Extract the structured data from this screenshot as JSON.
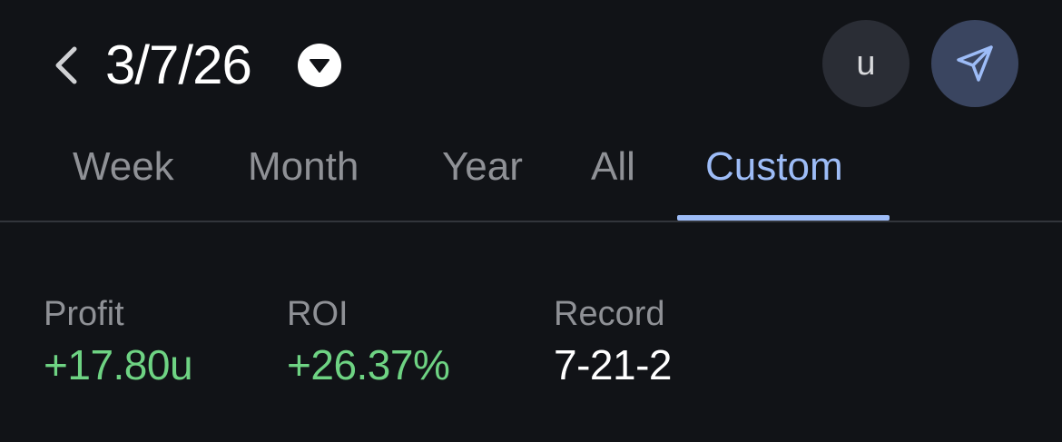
{
  "header": {
    "date": "3/7/26",
    "unit_label": "u",
    "icons": {
      "back": "chevron-left-icon",
      "dropdown": "caret-down-icon",
      "share": "send-icon"
    }
  },
  "tabs": [
    {
      "label": "Week",
      "active": false
    },
    {
      "label": "Month",
      "active": false
    },
    {
      "label": "Year",
      "active": false
    },
    {
      "label": "All",
      "active": false
    },
    {
      "label": "Custom",
      "active": true
    }
  ],
  "stats": {
    "profit": {
      "label": "Profit",
      "value": "+17.80u"
    },
    "roi": {
      "label": "ROI",
      "value": "+26.37%"
    },
    "record": {
      "label": "Record",
      "value": "7-21-2"
    }
  },
  "colors": {
    "background": "#111317",
    "accent": "#9dbcf7",
    "positive": "#6ed383",
    "muted": "#8f9196"
  }
}
